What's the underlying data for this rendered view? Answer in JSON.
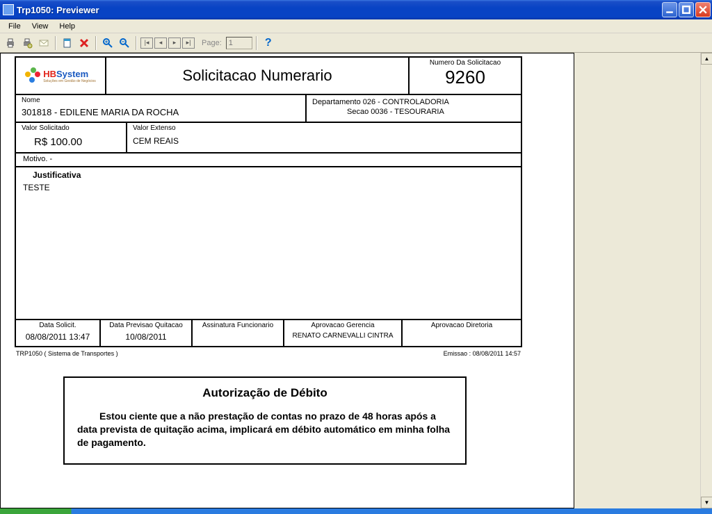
{
  "window": {
    "title": "Trp1050: Previewer"
  },
  "menu": {
    "file": "File",
    "view": "View",
    "help": "Help"
  },
  "toolbar": {
    "page_label": "Page:",
    "page_value": "1"
  },
  "logo": {
    "brand_a": "HB",
    "brand_b": "System",
    "tagline": "Soluções em Gestão de Negócios"
  },
  "report": {
    "title": "Solicitacao Numerario",
    "num_label": "Numero Da Solicitacao",
    "num_value": "9260",
    "nome_label": "Nome",
    "nome_value": "301818   - EDILENE MARIA DA ROCHA",
    "dept_line": "Departamento  026   - CONTROLADORIA",
    "secao_line": "Secao  0036   - TESOURARIA",
    "vsol_label": "Valor Solicitado",
    "vsol_value": "R$     100.00",
    "vext_label": "Valor Extenso",
    "vext_value": "CEM REAIS",
    "motivo": "Motivo.   -",
    "just_label": "Justificativa",
    "just_value": "TESTE",
    "sig": {
      "c1_label": "Data Solicit.",
      "c1_value": "08/08/2011 13:47",
      "c2_label": "Data Previsao Quitacao",
      "c2_value": "10/08/2011",
      "c3_label": "Assinatura Funcionario",
      "c4_label": "Aprovacao Gerencia",
      "c4_value": "RENATO CARNEVALLI CINTRA",
      "c5_label": "Aprovacao Diretoria"
    },
    "sysname": "TRP1050  ( Sistema de Transportes )",
    "emissao": "Emissao :   08/08/2011 14:57"
  },
  "auth": {
    "title": "Autorização de Débito",
    "body": "Estou ciente que a não prestação de contas no prazo de 48 horas após a data prevista de quitação acima, implicará em débito automático em minha folha de pagamento."
  }
}
